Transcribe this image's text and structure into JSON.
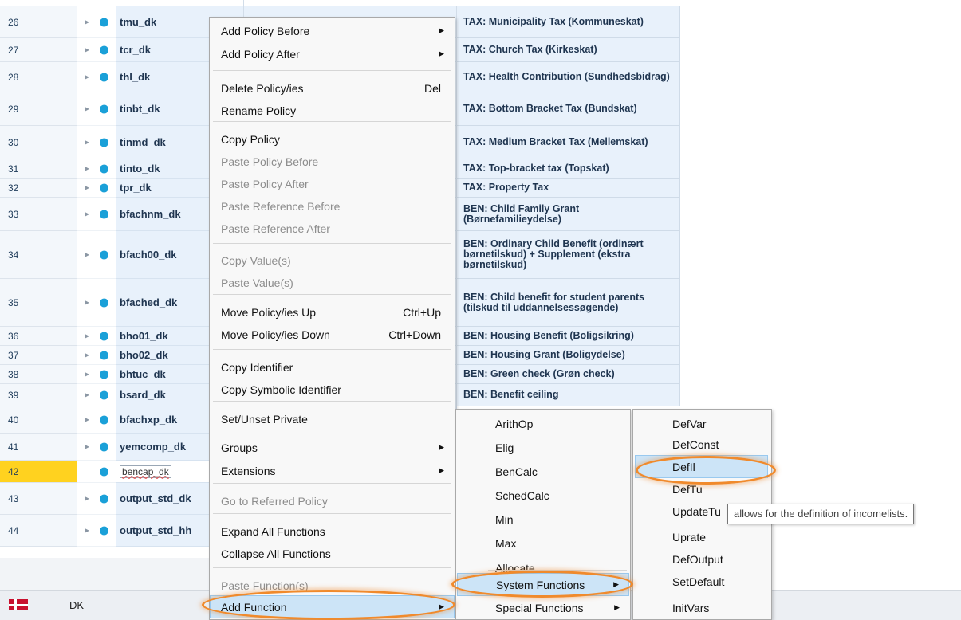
{
  "rows": [
    {
      "num": "26",
      "name": "tmu_dk",
      "desc": "TAX: Municipality Tax (Kommuneskat)"
    },
    {
      "num": "27",
      "name": "tcr_dk",
      "desc": "TAX: Church Tax (Kirkeskat)"
    },
    {
      "num": "28",
      "name": "thl_dk",
      "desc": "TAX: Health Contribution (Sundhedsbidrag)"
    },
    {
      "num": "29",
      "name": "tinbt_dk",
      "desc": "TAX: Bottom Bracket Tax (Bundskat)"
    },
    {
      "num": "30",
      "name": "tinmd_dk",
      "desc": "TAX: Medium Bracket Tax (Mellemskat)"
    },
    {
      "num": "31",
      "name": "tinto_dk",
      "desc": "TAX: Top-bracket tax (Topskat)"
    },
    {
      "num": "32",
      "name": "tpr_dk",
      "desc": "TAX: Property Tax"
    },
    {
      "num": "33",
      "name": "bfachnm_dk",
      "desc": "BEN: Child Family Grant (Børnefamilieydelse)"
    },
    {
      "num": "34",
      "name": "bfach00_dk",
      "desc": "BEN: Ordinary Child Benefit (ordinært børnetilskud) + Supplement (ekstra børnetilskud)"
    },
    {
      "num": "35",
      "name": "bfached_dk",
      "desc": "BEN: Child benefit for student parents (tilskud til uddannelsessøgende)"
    },
    {
      "num": "36",
      "name": "bho01_dk",
      "desc": "BEN: Housing Benefit (Boligsikring)"
    },
    {
      "num": "37",
      "name": "bho02_dk",
      "desc": "BEN: Housing Grant (Boligydelse)"
    },
    {
      "num": "38",
      "name": "bhtuc_dk",
      "desc": "BEN: Green check (Grøn check)"
    },
    {
      "num": "39",
      "name": "bsard_dk",
      "desc": "BEN: Benefit ceiling"
    },
    {
      "num": "40",
      "name": "bfachxp_dk",
      "desc": ""
    },
    {
      "num": "41",
      "name": "yemcomp_dk",
      "desc": ""
    },
    {
      "num": "42",
      "name": "bencap_dk",
      "desc": ""
    },
    {
      "num": "43",
      "name": "output_std_dk",
      "desc": ""
    },
    {
      "num": "44",
      "name": "output_std_hh",
      "desc": ""
    }
  ],
  "context_menu": {
    "items": [
      {
        "label": "Add Policy Before",
        "shortcut": "",
        "submenu": true,
        "disabled": false
      },
      {
        "label": "Add Policy After",
        "shortcut": "",
        "submenu": true,
        "disabled": false
      },
      {
        "label": "Delete Policy/ies",
        "shortcut": "Del",
        "submenu": false,
        "disabled": false
      },
      {
        "label": "Rename Policy",
        "shortcut": "",
        "submenu": false,
        "disabled": false
      },
      {
        "label": "Copy Policy",
        "shortcut": "",
        "submenu": false,
        "disabled": false
      },
      {
        "label": "Paste Policy Before",
        "shortcut": "",
        "submenu": false,
        "disabled": true
      },
      {
        "label": "Paste Policy After",
        "shortcut": "",
        "submenu": false,
        "disabled": true
      },
      {
        "label": "Paste Reference Before",
        "shortcut": "",
        "submenu": false,
        "disabled": true
      },
      {
        "label": "Paste Reference After",
        "shortcut": "",
        "submenu": false,
        "disabled": true
      },
      {
        "label": "Copy Value(s)",
        "shortcut": "",
        "submenu": false,
        "disabled": true
      },
      {
        "label": "Paste Value(s)",
        "shortcut": "",
        "submenu": false,
        "disabled": true
      },
      {
        "label": "Move Policy/ies Up",
        "shortcut": "Ctrl+Up",
        "submenu": false,
        "disabled": false
      },
      {
        "label": "Move Policy/ies Down",
        "shortcut": "Ctrl+Down",
        "submenu": false,
        "disabled": false
      },
      {
        "label": "Copy Identifier",
        "shortcut": "",
        "submenu": false,
        "disabled": false
      },
      {
        "label": "Copy Symbolic Identifier",
        "shortcut": "",
        "submenu": false,
        "disabled": false
      },
      {
        "label": "Set/Unset Private",
        "shortcut": "",
        "submenu": false,
        "disabled": false
      },
      {
        "label": "Groups",
        "shortcut": "",
        "submenu": true,
        "disabled": false
      },
      {
        "label": "Extensions",
        "shortcut": "",
        "submenu": true,
        "disabled": false
      },
      {
        "label": "Go to Referred Policy",
        "shortcut": "",
        "submenu": false,
        "disabled": true
      },
      {
        "label": "Expand All Functions",
        "shortcut": "",
        "submenu": false,
        "disabled": false
      },
      {
        "label": "Collapse All Functions",
        "shortcut": "",
        "submenu": false,
        "disabled": false
      },
      {
        "label": "Paste Function(s)",
        "shortcut": "",
        "submenu": false,
        "disabled": true
      },
      {
        "label": "Add Function",
        "shortcut": "",
        "submenu": true,
        "disabled": false,
        "highlighted": true
      }
    ]
  },
  "function_submenu": {
    "items": [
      {
        "label": "ArithOp",
        "submenu": false
      },
      {
        "label": "Elig",
        "submenu": false
      },
      {
        "label": "BenCalc",
        "submenu": false
      },
      {
        "label": "SchedCalc",
        "submenu": false
      },
      {
        "label": "Min",
        "submenu": false
      },
      {
        "label": "Max",
        "submenu": false
      },
      {
        "label": "Allocate",
        "submenu": false
      },
      {
        "label": "System Functions",
        "submenu": true,
        "highlighted": true
      },
      {
        "label": "Special Functions",
        "submenu": true
      }
    ]
  },
  "system_functions_submenu": {
    "items": [
      {
        "label": "DefVar"
      },
      {
        "label": "DefConst"
      },
      {
        "label": "DefIl",
        "highlighted": true
      },
      {
        "label": "DefTu"
      },
      {
        "label": "UpdateTu"
      },
      {
        "label": "Uprate"
      },
      {
        "label": "DefOutput"
      },
      {
        "label": "SetDefault"
      },
      {
        "label": "InitVars"
      }
    ]
  },
  "tooltip": "allows for the definition of incomelists.",
  "status": {
    "country": "DK",
    "flag": "denmark-flag-icon"
  },
  "colors": {
    "highlight_ring": "#f08a2c",
    "row_selected": "#ffd21f",
    "policy_dot": "#1aa0d8"
  }
}
